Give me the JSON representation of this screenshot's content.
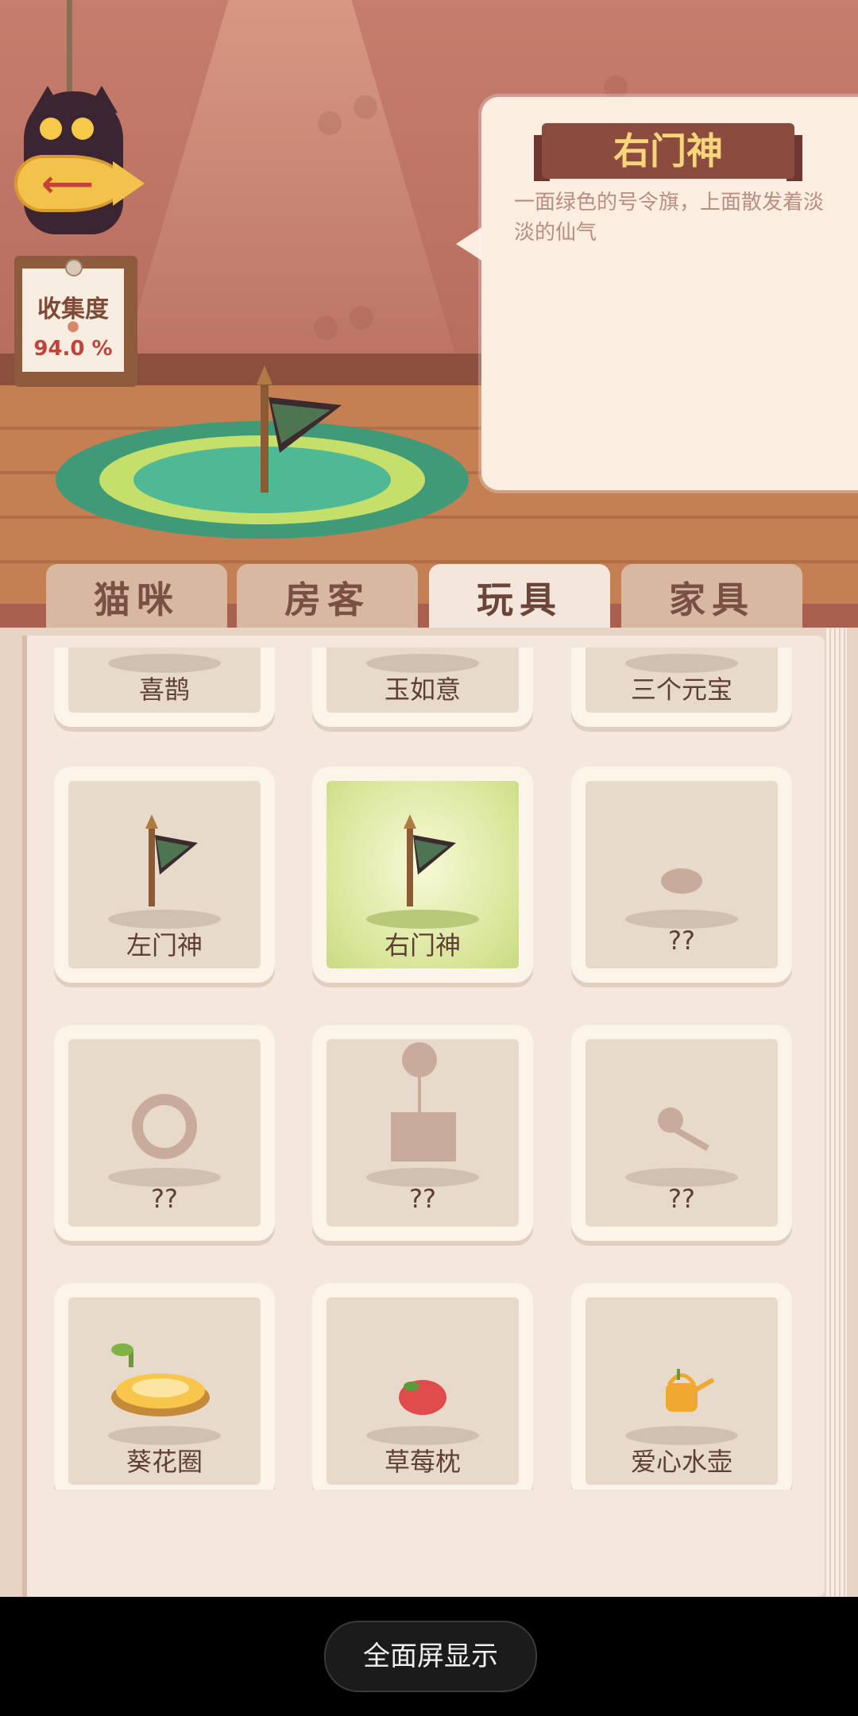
{
  "info_panel": {
    "title": "右门神",
    "description": "一面绿色的号令旗，上面散发着淡淡的仙气"
  },
  "collection": {
    "label": "收集度",
    "value": "94.0 %"
  },
  "tabs": [
    {
      "label": "猫咪",
      "active": false
    },
    {
      "label": "房客",
      "active": false
    },
    {
      "label": "玩具",
      "active": true
    },
    {
      "label": "家具",
      "active": false
    }
  ],
  "items": [
    {
      "label": "喜鹊",
      "icon": "magpie-icon"
    },
    {
      "label": "玉如意",
      "icon": "ruyi-icon"
    },
    {
      "label": "三个元宝",
      "icon": "ingot-icon"
    },
    {
      "label": "左门神",
      "icon": "flag-icon"
    },
    {
      "label": "右门神",
      "icon": "flag-icon",
      "selected": true
    },
    {
      "label": "??",
      "icon": "locked-cushion-icon"
    },
    {
      "label": "??",
      "icon": "locked-wreath-icon"
    },
    {
      "label": "??",
      "icon": "locked-balloon-gift-icon"
    },
    {
      "label": "??",
      "icon": "locked-wand-icon"
    },
    {
      "label": "葵花圈",
      "icon": "sunflower-ring-icon"
    },
    {
      "label": "草莓枕",
      "icon": "strawberry-pillow-icon"
    },
    {
      "label": "爱心水壶",
      "icon": "watering-can-icon"
    }
  ],
  "system": {
    "fullscreen_label": "全面屏显示"
  },
  "colors": {
    "wall": "#c77d6c",
    "floor": "#c47f53",
    "panel": "#fbeee0",
    "ribbon": "#8b4b3f",
    "ribbon_text": "#f7d57a",
    "selected_card": "#d9e69a",
    "flag_green": "#3f6b4c"
  }
}
